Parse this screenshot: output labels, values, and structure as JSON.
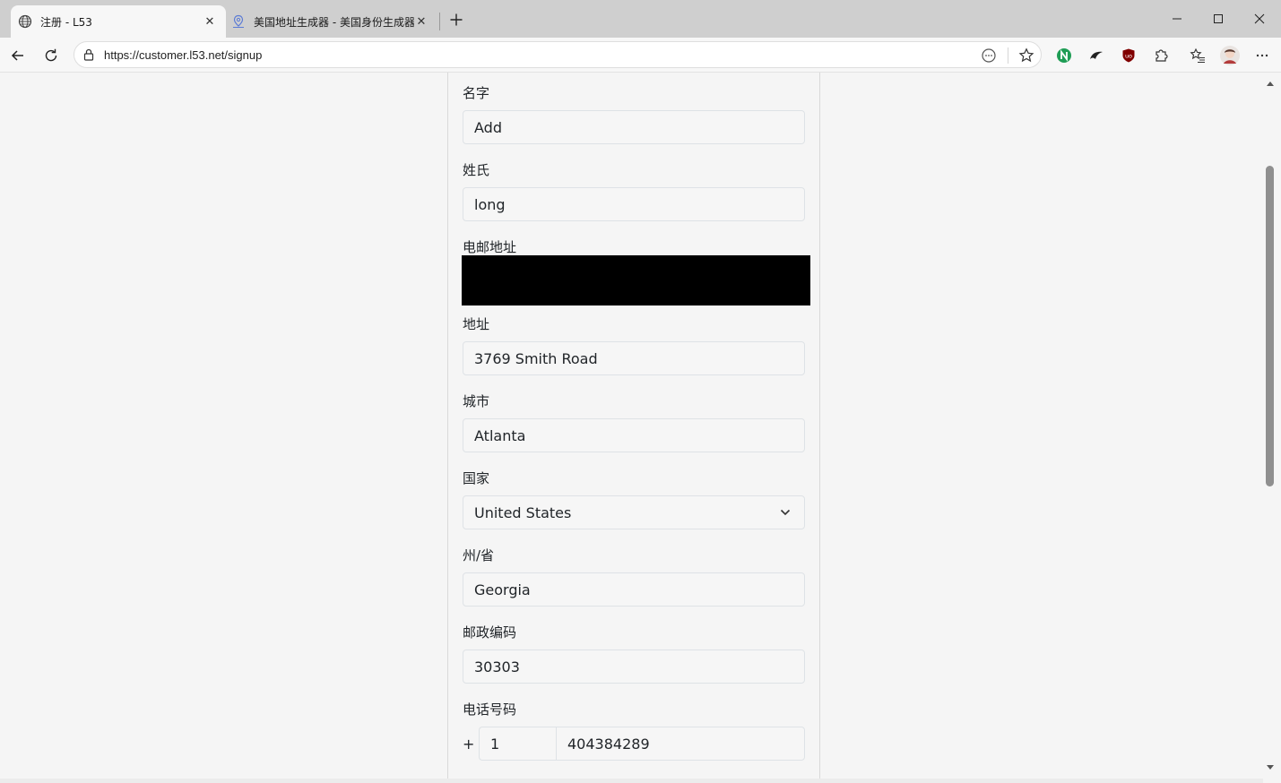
{
  "browser": {
    "tabs": [
      {
        "title": "注册 - L53",
        "icon": "globe-icon"
      },
      {
        "title": "美国地址生成器 - 美国身份生成器",
        "icon": "map-pin-icon"
      }
    ],
    "url": "https://customer.l53.net/signup"
  },
  "form": {
    "first_name": {
      "label": "名字",
      "value": "Add"
    },
    "last_name": {
      "label": "姓氏",
      "value": "long"
    },
    "email": {
      "label": "电邮地址"
    },
    "address": {
      "label": "地址",
      "value": "3769 Smith Road"
    },
    "city": {
      "label": "城市",
      "value": "Atlanta"
    },
    "country": {
      "label": "国家",
      "value": "United States"
    },
    "state": {
      "label": "州/省",
      "value": "Georgia"
    },
    "postcode": {
      "label": "邮政编码",
      "value": "30303"
    },
    "phone": {
      "label": "电话号码",
      "prefix": "+",
      "country_code": "1",
      "number": "404384289"
    }
  },
  "colors": {
    "tab_strip": "#cfcfcf",
    "page_background": "#f5f5f5",
    "input_border": "#dee2e6",
    "redaction": "#000000"
  }
}
